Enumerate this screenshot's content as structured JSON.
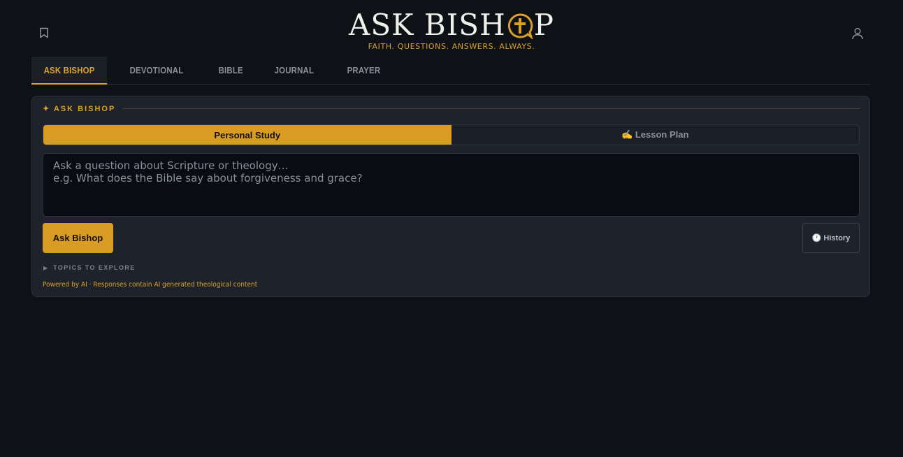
{
  "header": {
    "logo_title_left": "ASK BISH",
    "logo_title_right": "P",
    "tagline": "FAITH. QUESTIONS. ANSWERS. ALWAYS."
  },
  "tabs": [
    {
      "label": "ASK BISHOP",
      "active": true
    },
    {
      "label": "DEVOTIONAL",
      "active": false
    },
    {
      "label": "BIBLE",
      "active": false
    },
    {
      "label": "JOURNAL",
      "active": false
    },
    {
      "label": "PRAYER",
      "active": false
    }
  ],
  "card": {
    "section_label": "✦ ASK BISHOP",
    "modes": {
      "personal_study": "Personal Study",
      "lesson_plan": "✍️ Lesson Plan",
      "selected": "Personal Study"
    },
    "question": {
      "placeholder": "Ask a question about Scripture or theology…\ne.g. What does the Bible say about forgiveness and grace?",
      "value": ""
    },
    "ask_button": "Ask Bishop",
    "history_button": "🕐 History",
    "topics_label": "TOPICS TO EXPLORE",
    "disclaimer": "Powered by AI · Responses contain AI generated theological content"
  },
  "colors": {
    "accent": "#d89b24",
    "background": "#0e1116",
    "card": "#1e232b"
  },
  "icons": {
    "top_left": "bookmark-icon",
    "top_right": "user-icon",
    "logo_o": "cross-speech-bubble-icon",
    "topics": "triangle-right-icon"
  }
}
